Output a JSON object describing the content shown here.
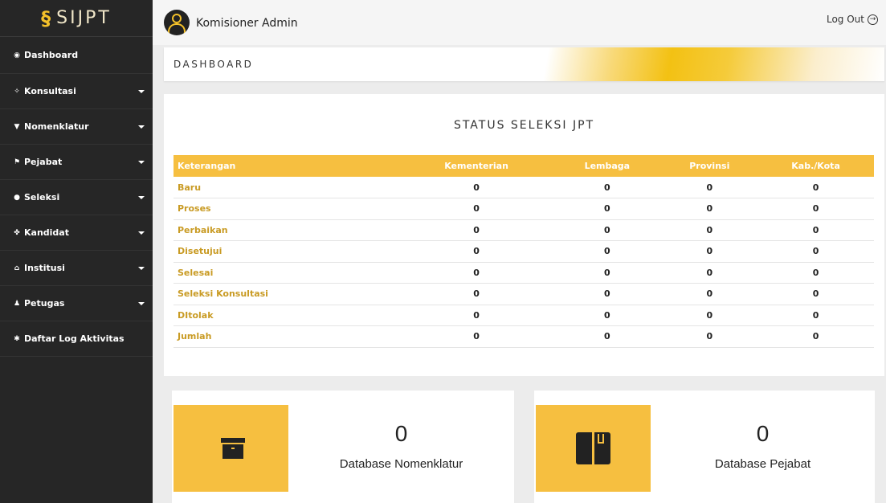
{
  "brand": {
    "logo_glyph": "§",
    "name": "SIJPT"
  },
  "sidebar": {
    "items": [
      {
        "icon": "◉",
        "icon_name": "dashboard-icon",
        "label": "Dashboard",
        "has_caret": false
      },
      {
        "icon": "✧",
        "icon_name": "konsultasi-icon",
        "label": "Konsultasi",
        "has_caret": true
      },
      {
        "icon": "▼",
        "icon_name": "filter-icon",
        "label": "Nomenklatur",
        "has_caret": true
      },
      {
        "icon": "⚑",
        "icon_name": "flag-icon",
        "label": "Pejabat",
        "has_caret": true
      },
      {
        "icon": "●",
        "icon_name": "seleksi-icon",
        "label": "Seleksi",
        "has_caret": true
      },
      {
        "icon": "✤",
        "icon_name": "users-icon",
        "label": "Kandidat",
        "has_caret": true
      },
      {
        "icon": "⌂",
        "icon_name": "home-icon",
        "label": "Institusi",
        "has_caret": true
      },
      {
        "icon": "♟",
        "icon_name": "user-icon",
        "label": "Petugas",
        "has_caret": true
      },
      {
        "icon": "✱",
        "icon_name": "gear-icon",
        "label": "Daftar Log Aktivitas",
        "has_caret": false
      }
    ]
  },
  "header": {
    "username": "Komisioner Admin",
    "logout_label": "Log Out",
    "logout_glyph": "→"
  },
  "breadcrumb": {
    "title": "DASHBOARD"
  },
  "status": {
    "title": "STATUS SELEKSI JPT",
    "columns": [
      "Keterangan",
      "Kementerian",
      "Lembaga",
      "Provinsi",
      "Kab./Kota"
    ],
    "rows": [
      [
        "Baru",
        "0",
        "0",
        "0",
        "0"
      ],
      [
        "Proses",
        "0",
        "0",
        "0",
        "0"
      ],
      [
        "Perbaikan",
        "0",
        "0",
        "0",
        "0"
      ],
      [
        "Disetujui",
        "0",
        "0",
        "0",
        "0"
      ],
      [
        "Selesai",
        "0",
        "0",
        "0",
        "0"
      ],
      [
        "Seleksi Konsultasi",
        "0",
        "0",
        "0",
        "0"
      ],
      [
        "DItolak",
        "0",
        "0",
        "0",
        "0"
      ],
      [
        "Jumlah",
        "0",
        "0",
        "0",
        "0"
      ]
    ]
  },
  "cards": [
    {
      "count": "0",
      "caption": "Database Nomenklatur",
      "icon_name": "archive-icon"
    },
    {
      "count": "0",
      "caption": "Database Pejabat",
      "icon_name": "book-icon"
    }
  ],
  "colors": {
    "accent": "#f6bf40",
    "sidebar_bg": "#262626",
    "link_gold": "#c99b24"
  }
}
